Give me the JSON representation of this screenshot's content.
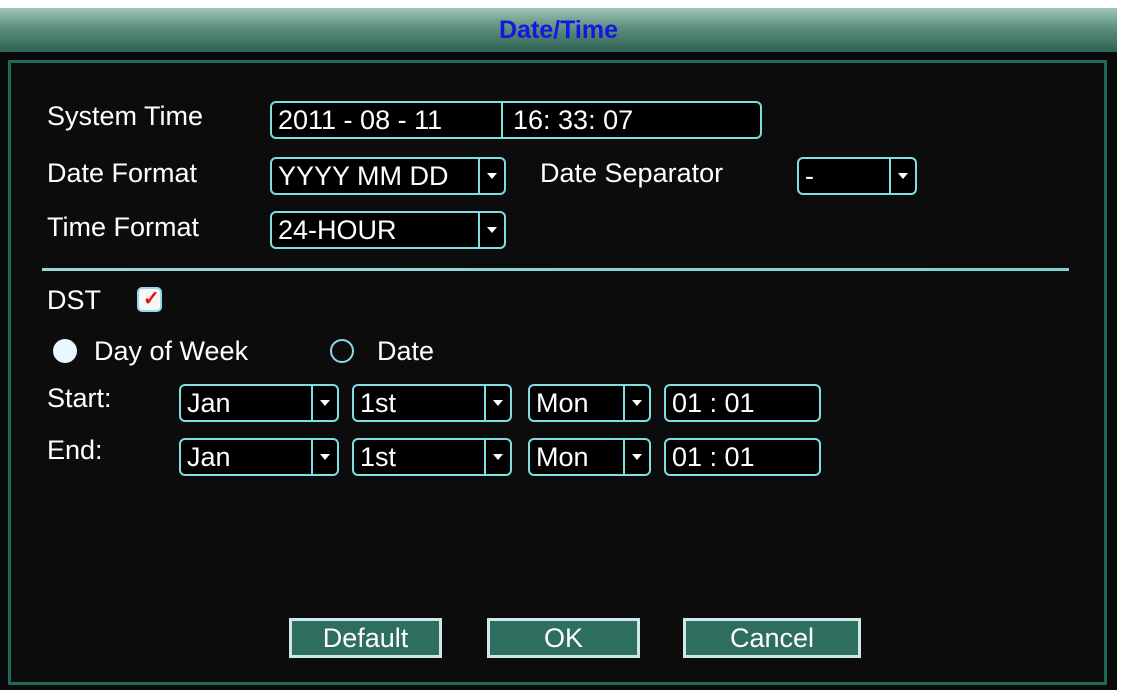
{
  "window": {
    "title": "Date/Time"
  },
  "general": {
    "system_time_label": "System Time",
    "system_date": "2011 - 08 - 11",
    "system_clock": "16: 33: 07",
    "date_format_label": "Date Format",
    "date_format_value": "YYYY MM DD",
    "date_separator_label": "Date Separator",
    "date_separator_value": "-",
    "time_format_label": "Time Format",
    "time_format_value": "24-HOUR"
  },
  "dst": {
    "label": "DST",
    "checked": true,
    "mode_options": [
      "Day of Week",
      "Date"
    ],
    "selected_mode": "Day of Week",
    "start": {
      "label": "Start:",
      "month": "Jan",
      "week": "1st",
      "day": "Mon",
      "time": "01 : 01"
    },
    "end": {
      "label": "End:",
      "month": "Jan",
      "week": "1st",
      "day": "Mon",
      "time": "01 : 01"
    }
  },
  "buttons": {
    "default_label": "Default",
    "ok_label": "OK",
    "cancel_label": "Cancel"
  },
  "colors": {
    "title_text": "#1616e0",
    "field_border": "#7ee0e4",
    "button_bg": "#2e6e5e",
    "checkmark": "#e01010"
  }
}
